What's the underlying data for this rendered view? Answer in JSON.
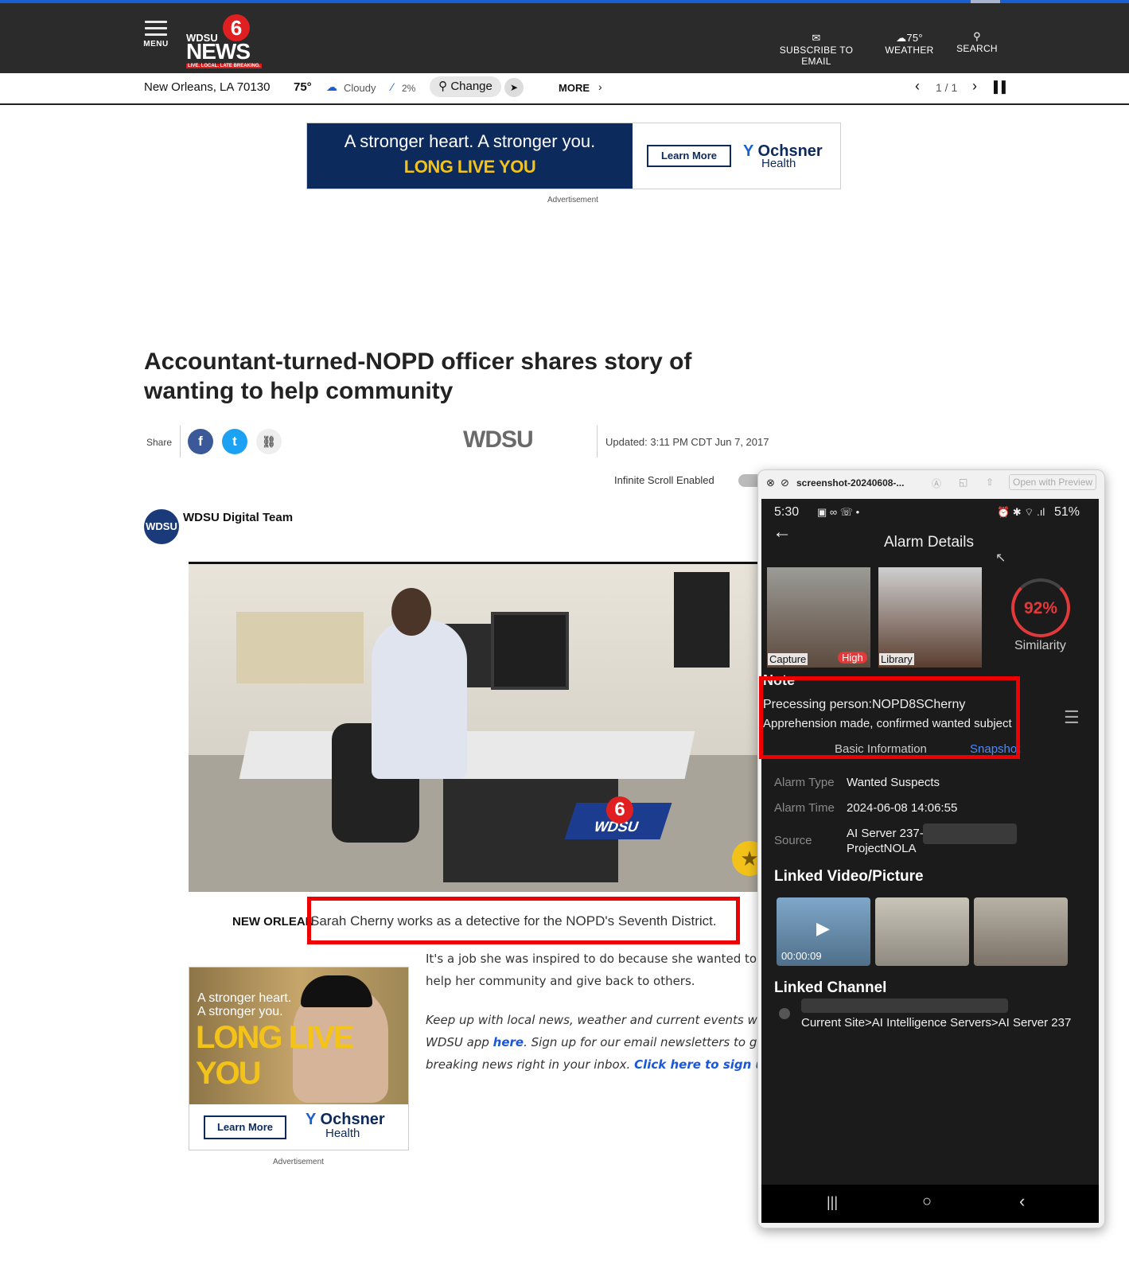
{
  "header": {
    "menu_label": "MENU",
    "logo": {
      "small": "WDSU",
      "big": "NEWS",
      "tag": "LIVE. LOCAL. LATE BREAKING.",
      "channel": "6"
    },
    "subscribe_label": "SUBSCRIBE TO EMAIL",
    "weather_temp": "75°",
    "weather_label": "WEATHER",
    "search_label": "SEARCH"
  },
  "subbar": {
    "location": "New Orleans, LA 70130",
    "temp": "75°",
    "condition": "Cloudy",
    "precip": "2%",
    "change_label": "Change",
    "more_label": "MORE",
    "pager": "1 / 1"
  },
  "ad_top": {
    "line1": "A stronger heart. A stronger you.",
    "line2": "LONG LIVE YOU",
    "cta": "Learn More",
    "brand1": "Ochsner",
    "brand2": "Health",
    "label": "Advertisement"
  },
  "article": {
    "title": "Accountant-turned-NOPD officer shares story of wanting to help community",
    "share_label": "Share",
    "brand_mark": "WDSU",
    "updated": "Updated: 3:11 PM CDT Jun 7, 2017",
    "infinite_scroll": "Infinite Scroll Enabled",
    "author": "WDSU Digital Team",
    "dateline": "NEW ORLEAN",
    "caption": "Sarah Cherny works as a detective for the NOPD's Seventh District.",
    "para1": "It's a job she was inspired to do because she wanted to help her community and give back to others.",
    "para2_a": "Keep up with local news, weather and current events with th",
    "para2_b": "WDSU app ",
    "para2_link1": "here",
    "para2_c": ". Sign up for our email newsletters to get",
    "para2_d": "breaking news right in your inbox. ",
    "para2_link2": "Click here to sign up!"
  },
  "ad_side": {
    "line1": "A stronger heart.",
    "line2": "A stronger you.",
    "line3": "LONG LIVE YOU",
    "cta": "Learn More",
    "brand1": "Ochsner",
    "brand2": "Health",
    "label": "Advertisement"
  },
  "viewer": {
    "filename": "screenshot-20240608-...",
    "open_with": "Open with Preview"
  },
  "phone": {
    "time": "5:30",
    "battery": "51%",
    "title": "Alarm Details",
    "capture_label": "Capture",
    "high_label": "High",
    "library_label": "Library",
    "similarity_value": "92%",
    "similarity_label": "Similarity",
    "note_heading": "Note",
    "note_line1": "Precessing person:NOPD8SCherny",
    "note_line2": "Apprehension made, confirmed wanted subject",
    "tab_basic": "Basic Information",
    "tab_snapshot": "Snapshot",
    "alarm_type_key": "Alarm Type",
    "alarm_type_val": "Wanted Suspects",
    "alarm_time_key": "Alarm Time",
    "alarm_time_val": "2024-06-08 14:06:55",
    "source_key": "Source",
    "source_val1": "AI Server 237-",
    "source_val2": "ProjectNOLA",
    "linked_video_heading": "Linked Video/Picture",
    "video_duration": "00:00:09",
    "linked_channel_heading": "Linked Channel",
    "channel_path": "Current Site>AI Intelligence Servers>AI Server 237"
  }
}
